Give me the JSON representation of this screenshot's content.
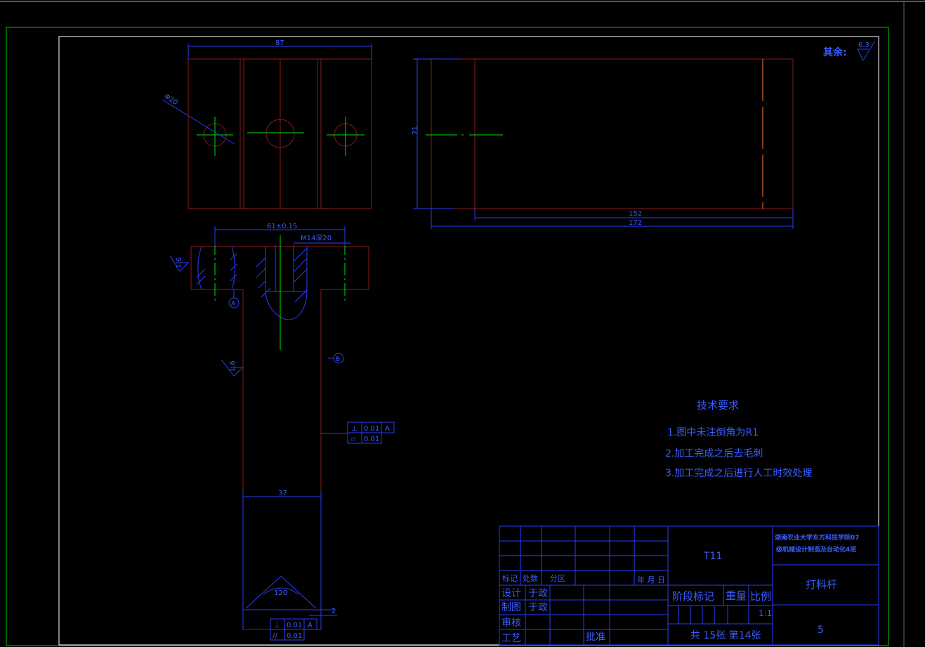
{
  "drawing": {
    "dims": {
      "top_width": "87",
      "hole_dia": "Φ20",
      "height": "71",
      "len_152": "152",
      "len_172": "172",
      "dim_61": "61±0.15",
      "thread": "M14深20",
      "rough_16a": "1.6",
      "rough_16b": "1.6",
      "dim_37": "37",
      "angle_120": "120",
      "dim_2": "2"
    },
    "datums": {
      "a": "A",
      "b": "B"
    },
    "gdt1": {
      "row1_sym": "⊥",
      "row1_val": "0.01",
      "row1_ref": "A",
      "row2_sym": "▱",
      "row2_val": "0.01"
    },
    "gdt2": {
      "row1_sym": "⊥",
      "row1_val": "0.01",
      "row1_ref": "A",
      "row2_sym": "//",
      "row2_val": "0.01"
    },
    "roughness_note": {
      "label": "其余:",
      "value": "6.3"
    },
    "tech_req": {
      "title": "技术要求",
      "items": [
        "1.图中未注倒角为R1",
        "2.加工完成之后去毛刺",
        "3.加工完成之后进行人工时效处理"
      ]
    },
    "title_block": {
      "code": "T11",
      "school_line1": "湖南农业大学东方科技学院07",
      "school_line2": "级机械设计制造及自动化4班",
      "part_name": "打料杆",
      "sheet_no": "5",
      "headers": {
        "mark": "标记",
        "count": "处数",
        "zone": "分区",
        "date": "年 月 日"
      },
      "design_label": "设计",
      "design_name": "于政",
      "draw_label": "制图",
      "draw_name": "于政",
      "review_label": "审核",
      "process_label": "工艺",
      "approve_label": "批准",
      "stage_label": "阶段标记",
      "weight_label": "重量",
      "scale_label": "比例",
      "scale_value": "1:1",
      "sheets": "共 15张  第14张"
    },
    "colors": {
      "outline": "#8b1a1a",
      "dimension": "#2a3cff",
      "centerline": "#00e000",
      "frame": "#ffffff",
      "border": "#00c800"
    }
  }
}
